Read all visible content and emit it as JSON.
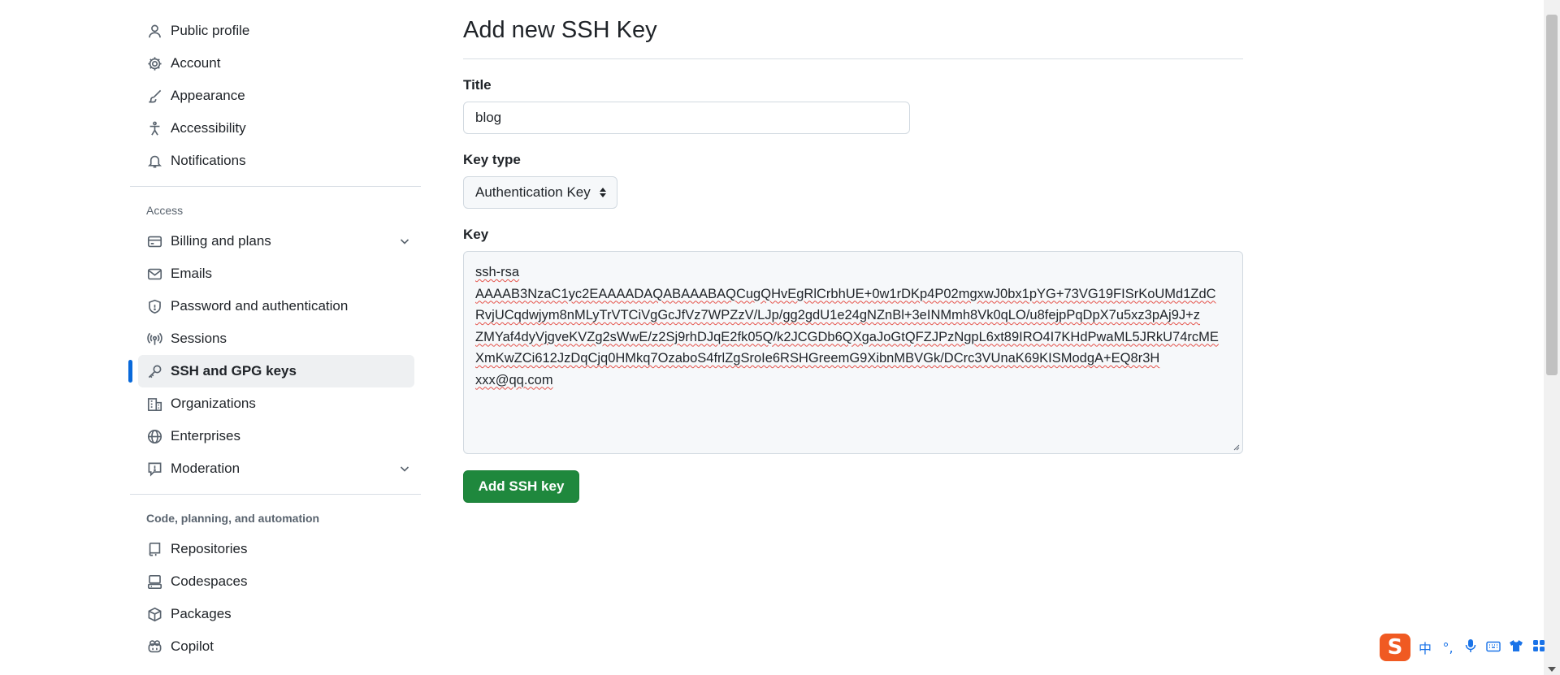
{
  "sidebar": {
    "items_top": [
      {
        "label": "Public profile",
        "icon": "person-icon"
      },
      {
        "label": "Account",
        "icon": "gear-icon"
      },
      {
        "label": "Appearance",
        "icon": "paintbrush-icon"
      },
      {
        "label": "Accessibility",
        "icon": "accessibility-icon"
      },
      {
        "label": "Notifications",
        "icon": "bell-icon"
      }
    ],
    "access_header": "Access",
    "items_access": [
      {
        "label": "Billing and plans",
        "icon": "credit-card-icon",
        "expandable": true
      },
      {
        "label": "Emails",
        "icon": "mail-icon"
      },
      {
        "label": "Password and authentication",
        "icon": "shield-icon"
      },
      {
        "label": "Sessions",
        "icon": "broadcast-icon"
      },
      {
        "label": "SSH and GPG keys",
        "icon": "key-icon",
        "active": true
      },
      {
        "label": "Organizations",
        "icon": "organization-icon"
      },
      {
        "label": "Enterprises",
        "icon": "globe-icon"
      },
      {
        "label": "Moderation",
        "icon": "report-icon",
        "expandable": true
      }
    ],
    "code_header": "Code, planning, and automation",
    "items_code": [
      {
        "label": "Repositories",
        "icon": "repo-icon"
      },
      {
        "label": "Codespaces",
        "icon": "codespaces-icon"
      },
      {
        "label": "Packages",
        "icon": "package-icon"
      },
      {
        "label": "Copilot",
        "icon": "copilot-icon"
      }
    ]
  },
  "main": {
    "title": "Add new SSH Key",
    "title_label": "Title",
    "title_value": "blog",
    "key_type_label": "Key type",
    "key_type_value": "Authentication Key",
    "key_label": "Key",
    "key_lines": [
      "ssh-rsa",
      "AAAAB3NzaC1yc2EAAAADAQABAAABAQCugQHvEgRlCrbhUE+0w1rDKp4P02mgxwJ0bx1pYG+73VG19FISrKoUMd1ZdC",
      "RvjUCqdwjym8nMLyTrVTCiVgGcJfVz7WPZzV/LJp/gg2gdU1e24gNZnBl+3eINMmh8Vk0qLO/u8fejpPqDpX7u5xz3pAj9J+z",
      "ZMYaf4dyVjgveKVZg2sWwE/z2Sj9rhDJqE2fk05Q/k2JCGDb6QXgaJoGtQFZJPzNgpL6xt89IRO4I7KHdPwaML5JRkU74rcME",
      "XmKwZCi612JzDqCjq0HMkq7OzaboS4frlZgSroIe6RSHGreemG9XibnMBVGk/DCrc3VUnaK69KISModgA+EQ8r3H",
      "xxx@qq.com"
    ],
    "submit_label": "Add SSH key"
  },
  "ime": {
    "logo": "S",
    "lang": "中",
    "punct": "°,",
    "mic": "mic-icon",
    "keyboard": "keyboard-icon",
    "skin": "shirt-icon",
    "apps": "grid-icon"
  },
  "colors": {
    "accent": "#0969da",
    "primary_button": "#1f883d",
    "text": "#1f2328",
    "muted": "#59636e",
    "ime_brand": "#f05a22"
  }
}
